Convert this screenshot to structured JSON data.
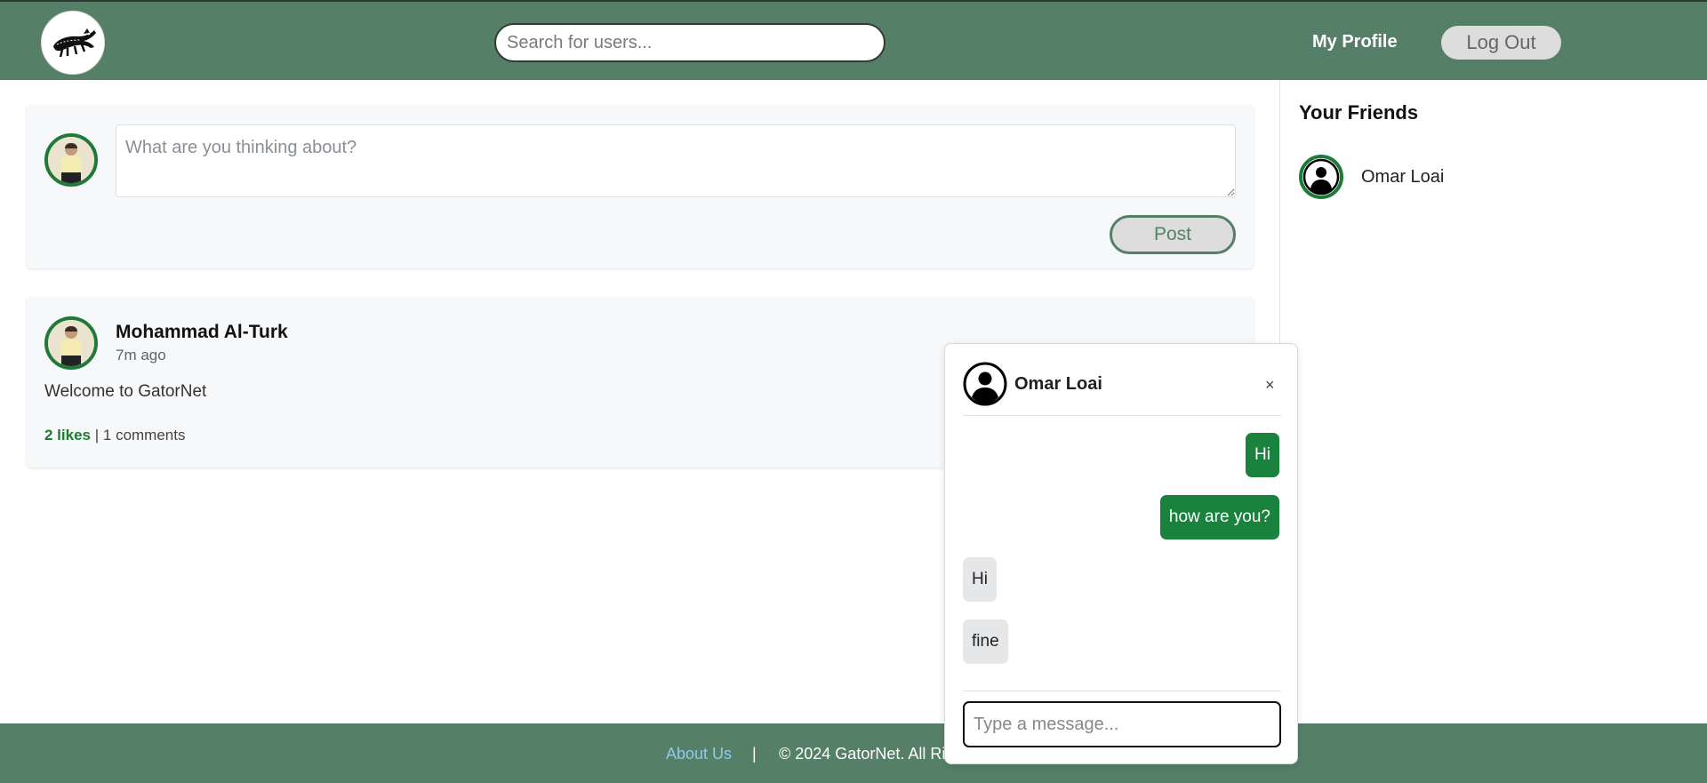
{
  "header": {
    "logo_alt": "GatorNet logo",
    "search_placeholder": "Search for users...",
    "nav_profile": "My Profile",
    "nav_logout": "Log Out"
  },
  "composer": {
    "placeholder": "What are you thinking about?",
    "post_button": "Post"
  },
  "posts": [
    {
      "author": "Mohammad Al-Turk",
      "time": "7m ago",
      "body": "Welcome to GatorNet",
      "likes": "2 likes",
      "separator": "|",
      "comments": "1 comments"
    }
  ],
  "friends": {
    "title": "Your Friends",
    "items": [
      {
        "name": "Omar Loai"
      }
    ]
  },
  "chat": {
    "name": "Omar Loai",
    "close": "×",
    "messages": [
      {
        "text": "Hi",
        "direction": "sent"
      },
      {
        "text": "how are you?",
        "direction": "sent"
      },
      {
        "text": "Hi",
        "direction": "received"
      },
      {
        "text": "fine",
        "direction": "received"
      }
    ],
    "input_placeholder": "Type a message..."
  },
  "footer": {
    "about": "About Us",
    "separator": "|",
    "copyright": "© 2024 GatorNet. All Rig"
  },
  "colors": {
    "header": "#567f67",
    "accent_green": "#19833d",
    "likes_green": "#1b7a33"
  }
}
